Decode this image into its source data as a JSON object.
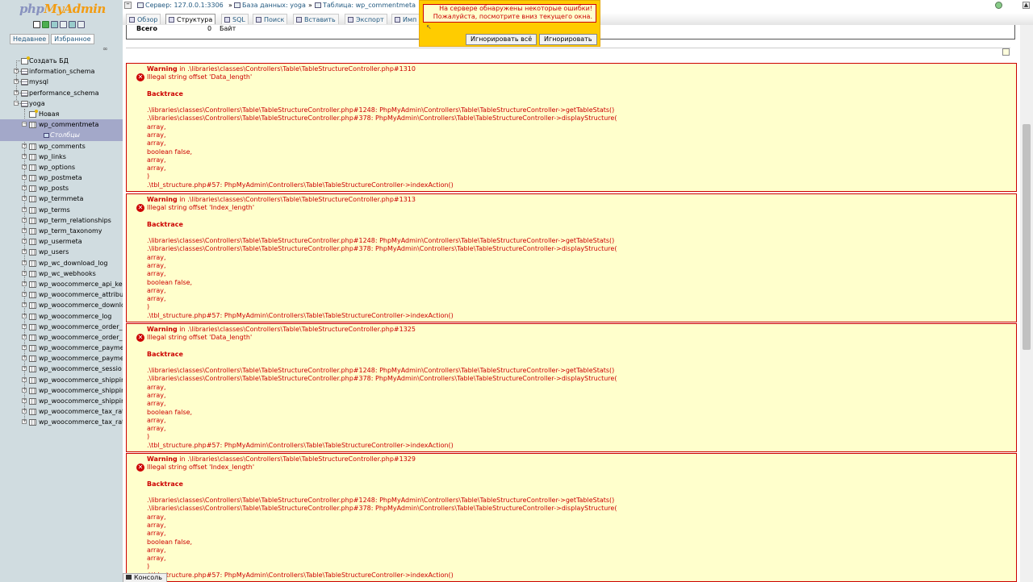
{
  "app": {
    "logo_part1": "php",
    "logo_part2": "MyAdmin"
  },
  "nav": {
    "tab_recent": "Недавнее",
    "tab_favorites": "Избранное",
    "link_icon": "∞"
  },
  "tree": {
    "create_db": "Создать БД",
    "databases": [
      {
        "label": "information_schema"
      },
      {
        "label": "mysql"
      },
      {
        "label": "performance_schema"
      },
      {
        "label": "yoga"
      }
    ],
    "yoga_children": [
      {
        "label": "Новая",
        "kind": "new"
      },
      {
        "label": "wp_commentmeta",
        "kind": "table",
        "selected": true
      },
      {
        "label": "Столбцы",
        "kind": "columns"
      },
      {
        "label": "wp_comments",
        "kind": "table"
      },
      {
        "label": "wp_links",
        "kind": "table"
      },
      {
        "label": "wp_options",
        "kind": "table"
      },
      {
        "label": "wp_postmeta",
        "kind": "table"
      },
      {
        "label": "wp_posts",
        "kind": "table"
      },
      {
        "label": "wp_termmeta",
        "kind": "table"
      },
      {
        "label": "wp_terms",
        "kind": "table"
      },
      {
        "label": "wp_term_relationships",
        "kind": "table"
      },
      {
        "label": "wp_term_taxonomy",
        "kind": "table"
      },
      {
        "label": "wp_usermeta",
        "kind": "table"
      },
      {
        "label": "wp_users",
        "kind": "table"
      },
      {
        "label": "wp_wc_download_log",
        "kind": "table"
      },
      {
        "label": "wp_wc_webhooks",
        "kind": "table"
      },
      {
        "label": "wp_woocommerce_api_ke",
        "kind": "table"
      },
      {
        "label": "wp_woocommerce_attribut",
        "kind": "table"
      },
      {
        "label": "wp_woocommerce_downlo",
        "kind": "table"
      },
      {
        "label": "wp_woocommerce_log",
        "kind": "table"
      },
      {
        "label": "wp_woocommerce_order_i",
        "kind": "table"
      },
      {
        "label": "wp_woocommerce_order_i",
        "kind": "table"
      },
      {
        "label": "wp_woocommerce_payme",
        "kind": "table"
      },
      {
        "label": "wp_woocommerce_payme",
        "kind": "table"
      },
      {
        "label": "wp_woocommerce_sessio",
        "kind": "table"
      },
      {
        "label": "wp_woocommerce_shippin",
        "kind": "table"
      },
      {
        "label": "wp_woocommerce_shippin",
        "kind": "table"
      },
      {
        "label": "wp_woocommerce_shippin",
        "kind": "table"
      },
      {
        "label": "wp_woocommerce_tax_rat",
        "kind": "table"
      },
      {
        "label": "wp_woocommerce_tax_rat",
        "kind": "table"
      }
    ]
  },
  "breadcrumb": {
    "server": "Сервер: 127.0.0.1:3306",
    "sep": "»",
    "database": "База данных: yoga",
    "table": "Таблица: wp_commentmeta"
  },
  "tabs": [
    {
      "label": "Обзор"
    },
    {
      "label": "Структура",
      "active": true
    },
    {
      "label": "SQL"
    },
    {
      "label": "Поиск"
    },
    {
      "label": "Вставить"
    },
    {
      "label": "Экспорт"
    },
    {
      "label": "Имп"
    }
  ],
  "summary": {
    "label": "Всего",
    "value": "0",
    "unit": "Байт"
  },
  "warnings": [
    {
      "header_prefix": "Warning",
      "header_suffix": " in .\\libraries\\classes\\Controllers\\Table\\TableStructureController.php#1310",
      "message": "Illegal string offset 'Data_length'",
      "backtrace_title": "Backtrace",
      "trace": [
        ".\\libraries\\classes\\Controllers\\Table\\TableStructureController.php#1248: PhpMyAdmin\\Controllers\\Table\\TableStructureController->getTableStats()",
        ".\\libraries\\classes\\Controllers\\Table\\TableStructureController.php#378: PhpMyAdmin\\Controllers\\Table\\TableStructureController->displayStructure(",
        "array,",
        "array,",
        "array,",
        "boolean false,",
        "array,",
        "array,",
        ")",
        ".\\tbl_structure.php#57: PhpMyAdmin\\Controllers\\Table\\TableStructureController->indexAction()"
      ]
    },
    {
      "header_prefix": "Warning",
      "header_suffix": " in .\\libraries\\classes\\Controllers\\Table\\TableStructureController.php#1313",
      "message": "Illegal string offset 'Index_length'",
      "backtrace_title": "Backtrace",
      "trace": [
        ".\\libraries\\classes\\Controllers\\Table\\TableStructureController.php#1248: PhpMyAdmin\\Controllers\\Table\\TableStructureController->getTableStats()",
        ".\\libraries\\classes\\Controllers\\Table\\TableStructureController.php#378: PhpMyAdmin\\Controllers\\Table\\TableStructureController->displayStructure(",
        "array,",
        "array,",
        "array,",
        "boolean false,",
        "array,",
        "array,",
        ")",
        ".\\tbl_structure.php#57: PhpMyAdmin\\Controllers\\Table\\TableStructureController->indexAction()"
      ]
    },
    {
      "header_prefix": "Warning",
      "header_suffix": " in .\\libraries\\classes\\Controllers\\Table\\TableStructureController.php#1325",
      "message": "Illegal string offset 'Data_length'",
      "backtrace_title": "Backtrace",
      "trace": [
        ".\\libraries\\classes\\Controllers\\Table\\TableStructureController.php#1248: PhpMyAdmin\\Controllers\\Table\\TableStructureController->getTableStats()",
        ".\\libraries\\classes\\Controllers\\Table\\TableStructureController.php#378: PhpMyAdmin\\Controllers\\Table\\TableStructureController->displayStructure(",
        "array,",
        "array,",
        "array,",
        "boolean false,",
        "array,",
        "array,",
        ")",
        ".\\tbl_structure.php#57: PhpMyAdmin\\Controllers\\Table\\TableStructureController->indexAction()"
      ]
    },
    {
      "header_prefix": "Warning",
      "header_suffix": " in .\\libraries\\classes\\Controllers\\Table\\TableStructureController.php#1329",
      "message": "Illegal string offset 'Index_length'",
      "backtrace_title": "Backtrace",
      "trace": [
        ".\\libraries\\classes\\Controllers\\Table\\TableStructureController.php#1248: PhpMyAdmin\\Controllers\\Table\\TableStructureController->getTableStats()",
        ".\\libraries\\classes\\Controllers\\Table\\TableStructureController.php#378: PhpMyAdmin\\Controllers\\Table\\TableStructureController->displayStructure(",
        "array,",
        "array,",
        "array,",
        "boolean false,",
        "array,",
        "array,",
        ")",
        ".\\tbl_structure.php#57: PhpMyAdmin\\Controllers\\Table\\TableStructureController->indexAction()"
      ]
    }
  ],
  "notice": {
    "line1": "На сервере обнаружены некоторые ошибки!",
    "line2": "Пожалуйста, посмотрите вниз текущего окна.",
    "ignore_all": "Игнорировать всё",
    "ignore": "Игнорировать"
  },
  "console": {
    "label": "Консоль"
  },
  "colors": {
    "error_red": "#cc0000",
    "warning_bg": "#ffffcc",
    "notice_bg": "#ffcc00",
    "nav_bg": "#d0dce0",
    "selected_bg": "#a3a8c9"
  }
}
